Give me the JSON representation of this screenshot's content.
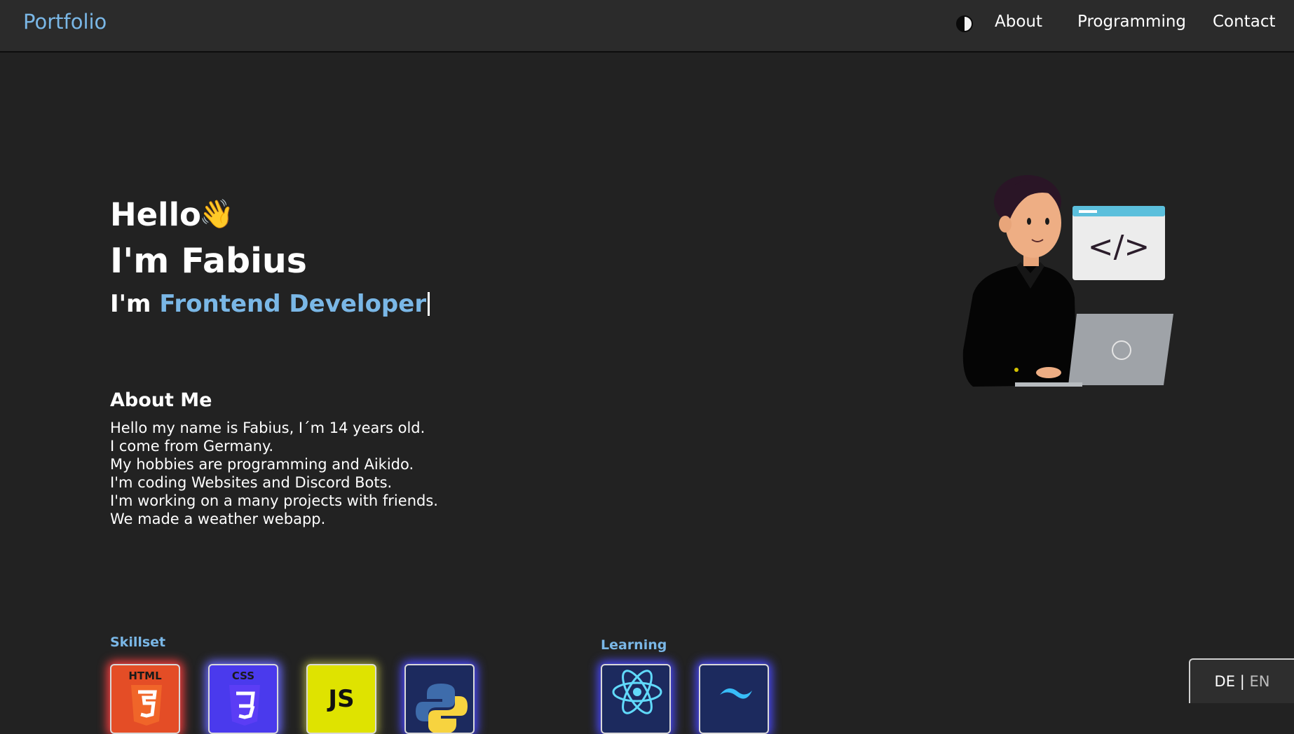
{
  "nav": {
    "brand": "Portfolio",
    "links": [
      "About",
      "Programming",
      "Contact"
    ]
  },
  "hero": {
    "greeting": "Hello",
    "wave_emoji": "👋",
    "name_line": "I'm Fabius",
    "role_prefix": "I'm",
    "role_highlight": "Frontend Developer"
  },
  "about": {
    "title": "About Me",
    "lines": [
      "Hello my name is Fabius, I´m 14 years old.",
      "I come from Germany.",
      "My hobbies are programming and Aikido.",
      "I'm coding Websites and Discord Bots.",
      "I'm working on a many projects with friends.",
      "We made a weather webapp."
    ]
  },
  "skillset": {
    "title": "Skillset",
    "items": [
      {
        "label": "HTML",
        "icon": "html5-icon"
      },
      {
        "label": "CSS",
        "icon": "css3-icon"
      },
      {
        "label": "JS",
        "icon": "javascript-icon"
      },
      {
        "label": "",
        "icon": "python-icon"
      }
    ]
  },
  "learning": {
    "title": "Learning",
    "items": [
      {
        "label": "",
        "icon": "react-icon"
      },
      {
        "label": "",
        "icon": "tailwind-icon"
      }
    ]
  },
  "language": {
    "de": "DE",
    "separator": "|",
    "en": "EN"
  },
  "colors": {
    "background": "#222222",
    "navbar": "#2b2b2b",
    "accent": "#7ab7e6"
  }
}
